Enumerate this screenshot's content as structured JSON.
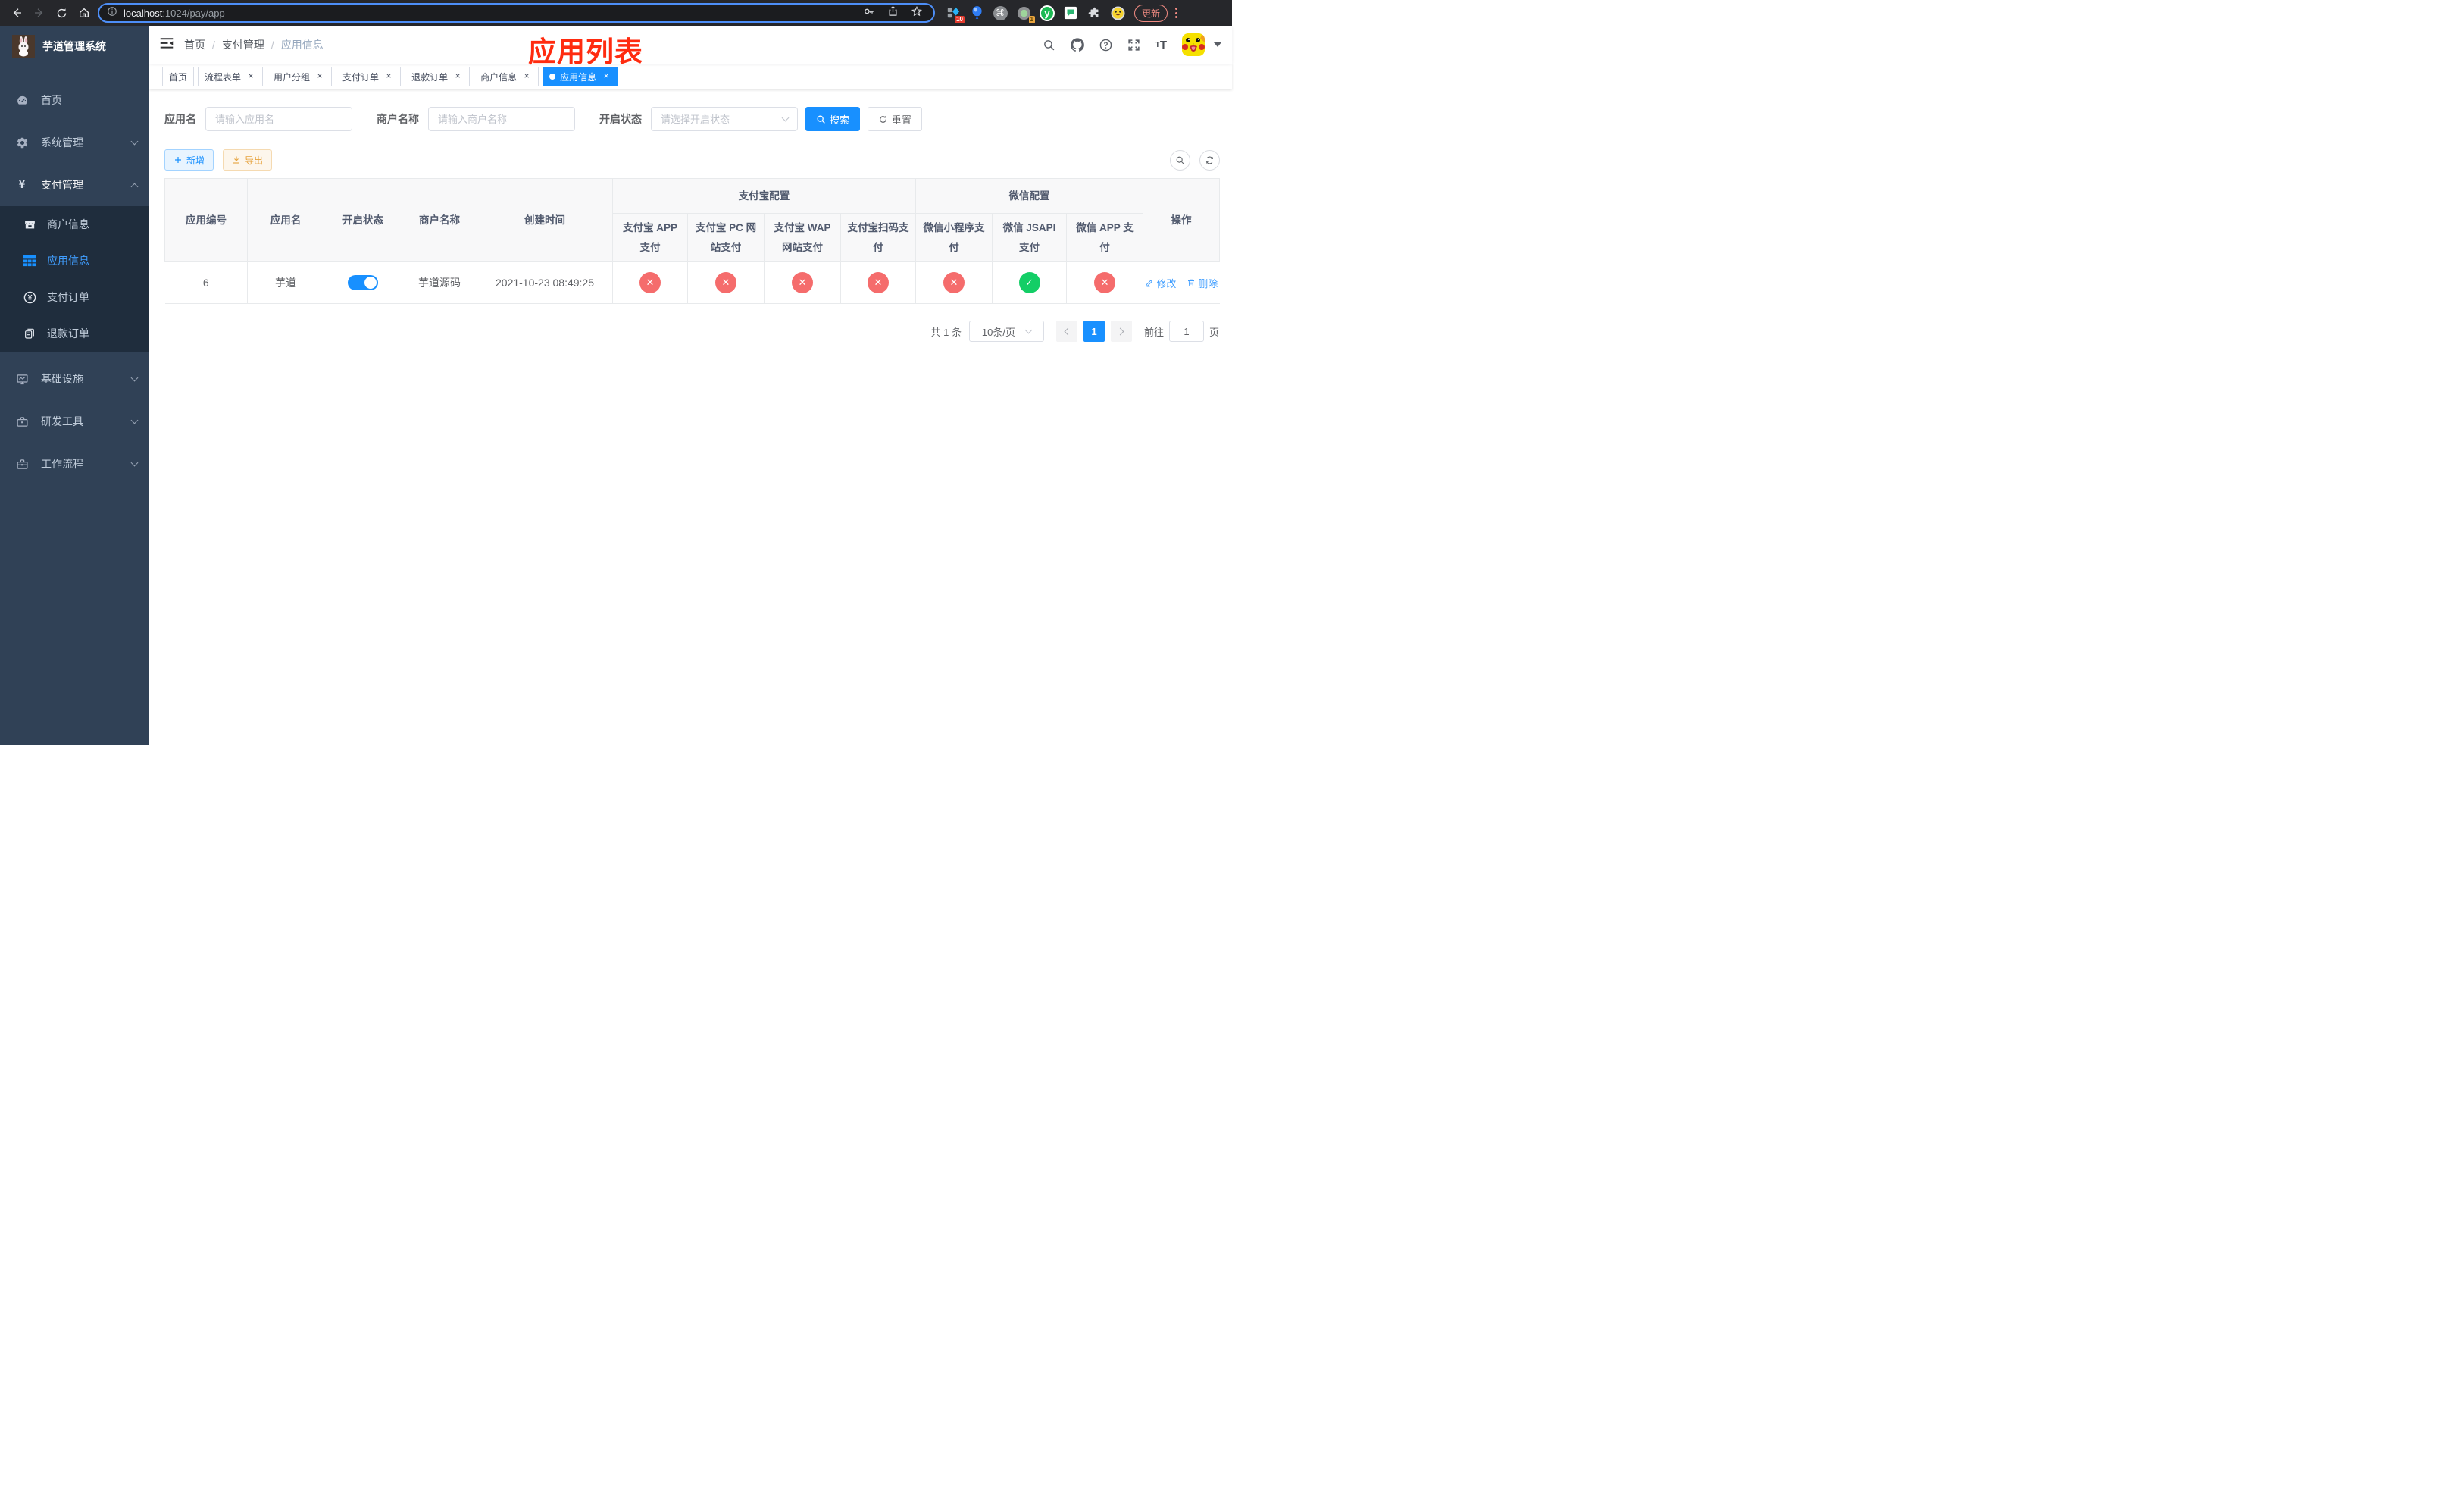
{
  "browser": {
    "url_host": "localhost",
    "url_rest": ":1024/pay/app",
    "update_label": "更新",
    "ext_badge_a": "10",
    "ext_badge_b": "1",
    "ext_y_label": "y"
  },
  "icons": {
    "close": "×",
    "command": "⌘",
    "yen": "¥",
    "check": "✓",
    "cross": "✕"
  },
  "sidebar": {
    "title": "芋道管理系统",
    "menu_home": "首页",
    "menu_system": "系统管理",
    "menu_pay": "支付管理",
    "sub_merchant": "商户信息",
    "sub_app": "应用信息",
    "sub_pay_order": "支付订单",
    "sub_refund_order": "退款订单",
    "menu_infra": "基础设施",
    "menu_devtools": "研发工具",
    "menu_workflow": "工作流程"
  },
  "navbar": {
    "breadcrumb": [
      "首页",
      "支付管理",
      "应用信息"
    ],
    "separator": "/"
  },
  "annotation": "应用列表",
  "tabs": [
    "首页",
    "流程表单",
    "用户分组",
    "支付订单",
    "退款订单",
    "商户信息",
    "应用信息"
  ],
  "filters": {
    "app_name_label": "应用名",
    "app_name_placeholder": "请输入应用名",
    "merchant_label": "商户名称",
    "merchant_placeholder": "请输入商户名称",
    "status_label": "开启状态",
    "status_placeholder": "请选择开启状态",
    "search_label": "搜索",
    "reset_label": "重置"
  },
  "toolbar": {
    "add_label": "新增",
    "export_label": "导出"
  },
  "table": {
    "group_alipay": "支付宝配置",
    "group_wechat": "微信配置",
    "col_id": "应用编号",
    "col_name": "应用名",
    "col_status": "开启状态",
    "col_merchant": "商户名称",
    "col_created": "创建时间",
    "col_alipay_app": "支付宝 APP 支付",
    "col_alipay_pc": "支付宝 PC 网站支付",
    "col_alipay_wap": "支付宝 WAP 网站支付",
    "col_alipay_qr": "支付宝扫码支付",
    "col_wx_mini": "微信小程序支付",
    "col_wx_jsapi": "微信 JSAPI 支付",
    "col_wx_app": "微信 APP 支付",
    "col_op": "操作",
    "row": {
      "id": "6",
      "name": "芋道",
      "enabled": true,
      "merchant": "芋道源码",
      "created": "2021-10-23 08:49:25",
      "payments": [
        "no",
        "no",
        "no",
        "no",
        "no",
        "yes",
        "no"
      ],
      "edit_label": "修改",
      "delete_label": "删除"
    }
  },
  "pagination": {
    "total": "共 1 条",
    "page_size": "10条/页",
    "current": "1",
    "goto_label": "前往",
    "goto_value": "1",
    "page_label": "页"
  },
  "colors": {
    "primary": "#1890ff",
    "success": "#13ce66",
    "danger": "#f56c6c",
    "warning": "#e6a23c",
    "sidebar": "#304156",
    "submenu": "#1f2d3d"
  }
}
